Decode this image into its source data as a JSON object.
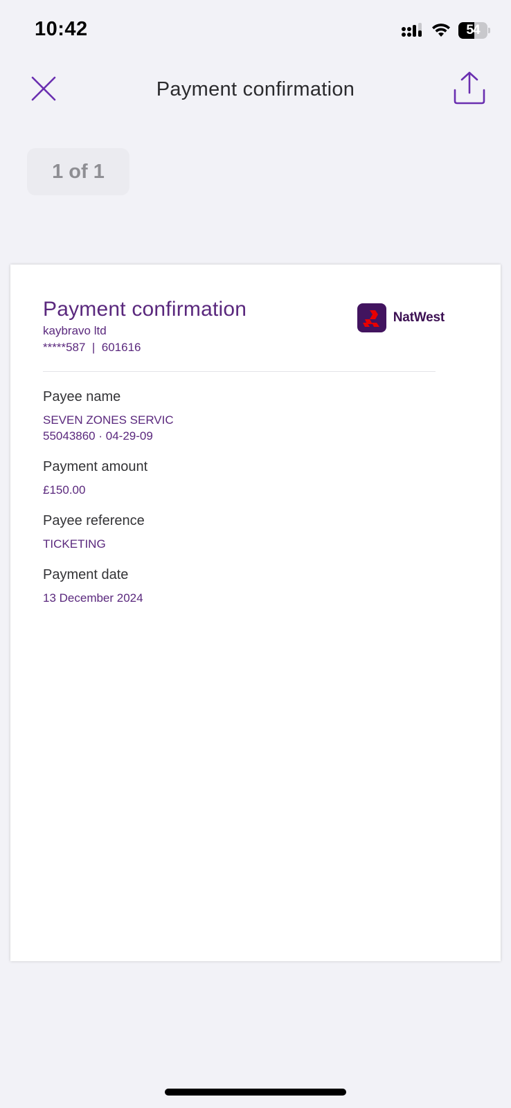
{
  "status_bar": {
    "time": "10:42",
    "battery_level": "54",
    "battery_fraction": 0.54
  },
  "nav": {
    "title": "Payment confirmation",
    "close_icon": "close-icon",
    "share_icon": "share-icon"
  },
  "page_counter": "1 of 1",
  "document": {
    "title": "Payment confirmation",
    "account_name": "kaybravo ltd",
    "account_number": "*****587  |  601616",
    "brand": {
      "name": "NatWest",
      "icon": "natwest-logo"
    },
    "fields": [
      {
        "label": "Payee name",
        "value_lines": [
          "SEVEN ZONES SERVIC",
          "55043860 · 04-29-09"
        ]
      },
      {
        "label": "Payment amount",
        "value_lines": [
          "£150.00"
        ]
      },
      {
        "label": "Payee reference",
        "value_lines": [
          "TICKETING"
        ]
      },
      {
        "label": "Payment date",
        "value_lines": [
          "13 December 2024"
        ]
      }
    ]
  },
  "colors": {
    "accent": "#5a287d",
    "brand_mark": "#42145f",
    "brand_red": "#e90000",
    "background": "#f2f2f7",
    "nav_icon": "#6a2fb0"
  }
}
